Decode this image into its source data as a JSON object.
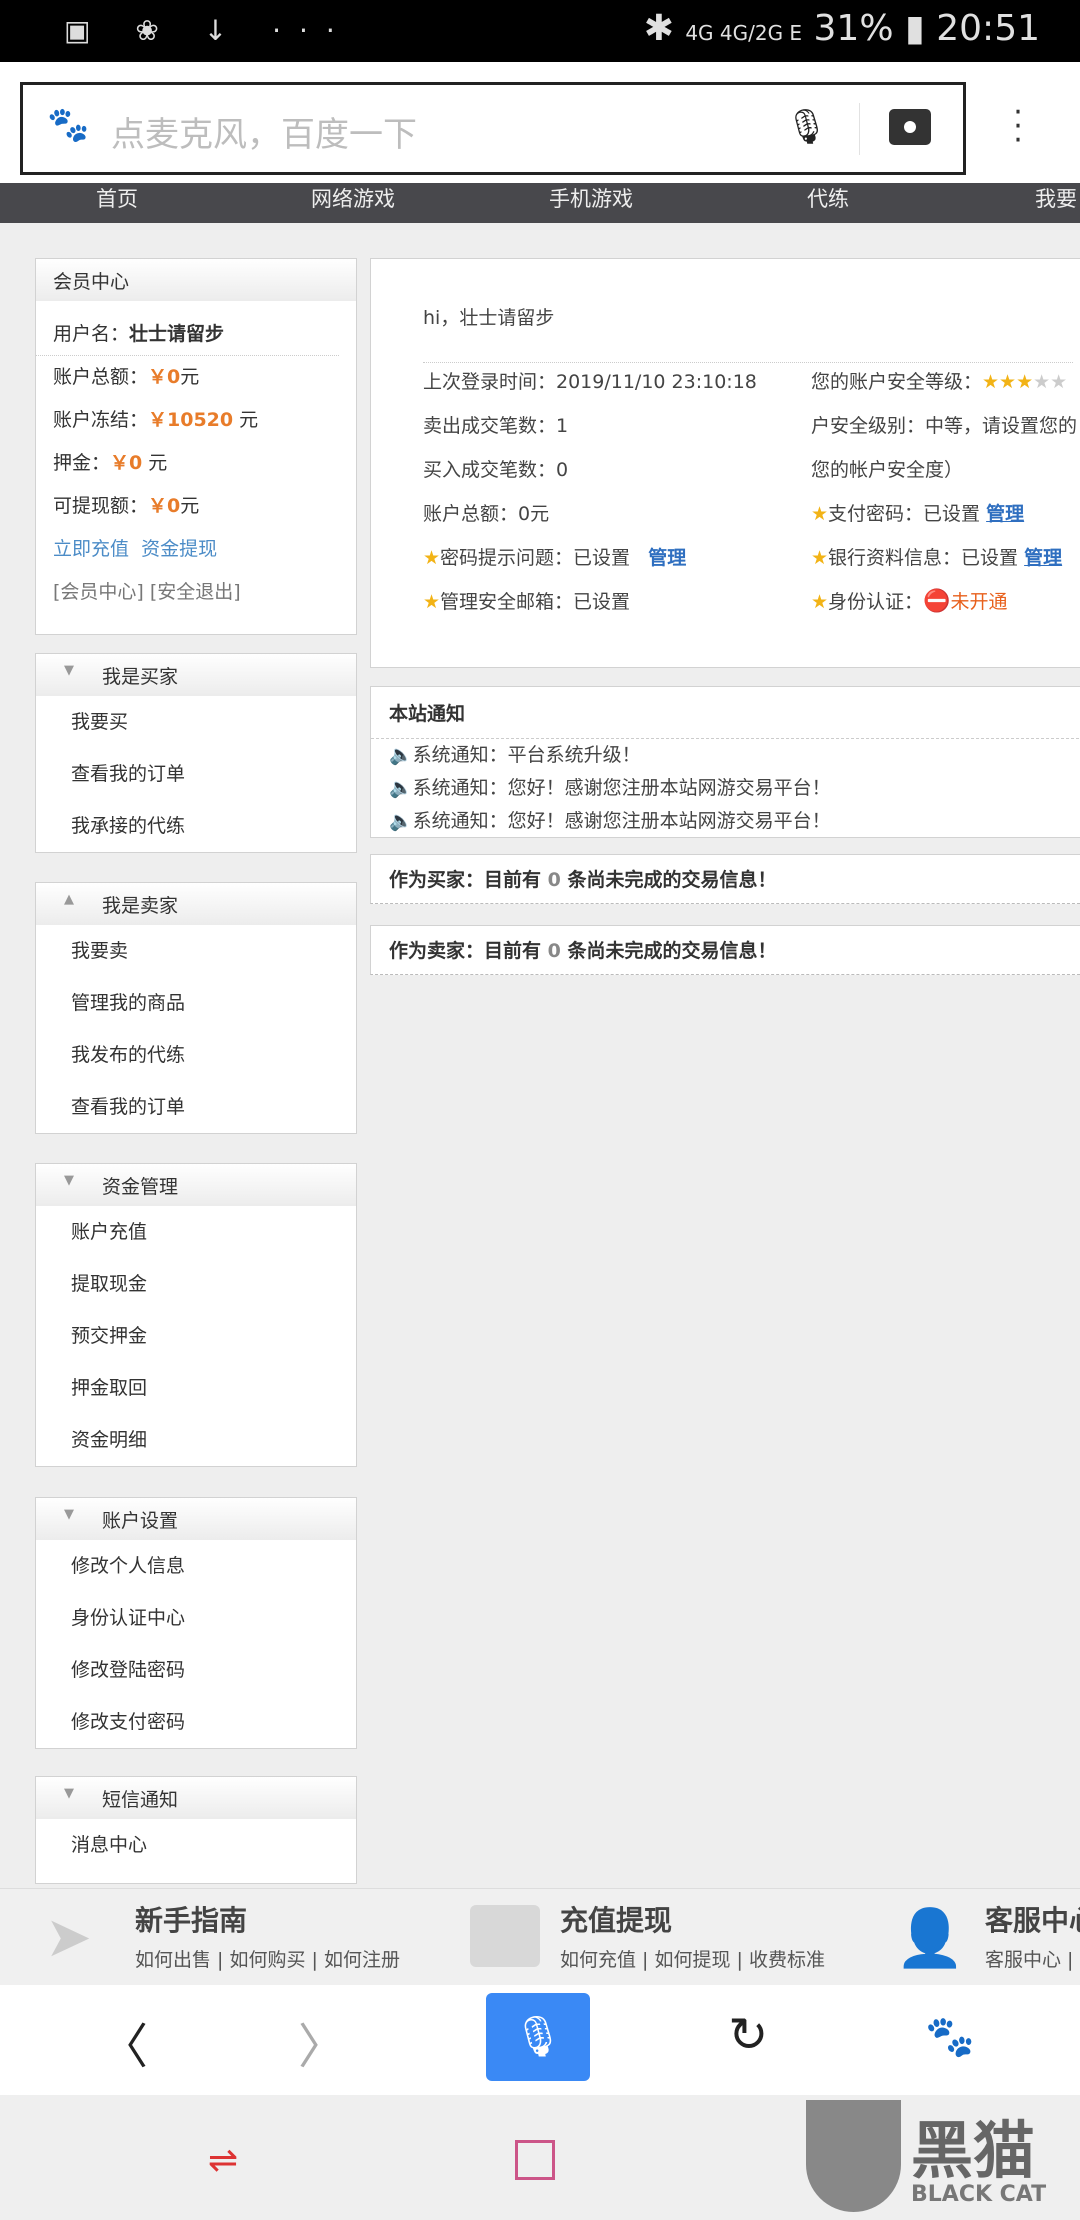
{
  "status": {
    "left_icons": "▣ ❀ ↓ ···",
    "bt": "✱",
    "battery": "31%",
    "time": "20:51",
    "network": "4G 4G/2G E"
  },
  "search": {
    "placeholder": "点麦克风，百度一下"
  },
  "nav": [
    "首页",
    "网络游戏",
    "手机游戏",
    "代练",
    "我要"
  ],
  "member": {
    "title": "会员中心",
    "username_label": "用户名：",
    "username": "壮士请留步",
    "total_label": "账户总额：",
    "total": "￥0",
    "total_unit": "元",
    "frozen_label": "账户冻结：",
    "frozen": "￥10520",
    "frozen_unit": " 元",
    "deposit_label": "押金：",
    "deposit": "￥0",
    "deposit_unit": " 元",
    "withdrawable_label": "可提现额：",
    "withdrawable": "￥0",
    "withdrawable_unit": "元",
    "recharge": "立即充值",
    "withdraw": "资金提现",
    "center": "[会员中心]",
    "logout": "[安全退出]"
  },
  "sections": [
    {
      "title": "我是买家",
      "items": [
        "我要买",
        "查看我的订单",
        "我承接的代练"
      ]
    },
    {
      "title": "我是卖家",
      "items": [
        "我要卖",
        "管理我的商品",
        "我发布的代练",
        "查看我的订单"
      ]
    },
    {
      "title": "资金管理",
      "items": [
        "账户充值",
        "提取现金",
        "预交押金",
        "押金取回",
        "资金明细"
      ]
    },
    {
      "title": "账户设置",
      "items": [
        "修改个人信息",
        "身份认证中心",
        "修改登陆密码",
        "修改支付密码"
      ]
    },
    {
      "title": "短信通知",
      "items": [
        "消息中心"
      ]
    }
  ],
  "info": {
    "greeting": "hi，壮士请留步",
    "last_login": "上次登录时间：2019/11/10 23:10:18",
    "sold": "卖出成交笔数：1",
    "bought": "买入成交笔数：0",
    "balance": "账户总额：0元",
    "pwd_hint": "密码提示问题：已设置",
    "email": "管理安全邮箱：已设置",
    "level_label": "您的账户安全等级：",
    "level_stars": 3,
    "level_max": 5,
    "level_text": "户安全级别：中等，请设置您的",
    "level_text2": "您的帐户安全度）",
    "pay_pwd": "支付密码：已设置",
    "bank": "银行资料信息：已设置",
    "id_auth": "身份认证：",
    "id_status": "未开通",
    "manage": "管理"
  },
  "notices": {
    "title": "本站通知",
    "items": [
      "系统通知：平台系统升级！",
      "系统通知：您好！感谢您注册本站网游交易平台！",
      "系统通知：您好！感谢您注册本站网游交易平台！"
    ]
  },
  "deals": {
    "buyer_pre": "作为买家：目前有 ",
    "buyer_count": "0",
    "buyer_post": " 条尚未完成的交易信息！",
    "seller_pre": "作为卖家：目前有 ",
    "seller_count": "0",
    "seller_post": " 条尚未完成的交易信息！"
  },
  "footer": [
    {
      "title": "新手指南",
      "links": "如何出售 | 如何购买 | 如何注册"
    },
    {
      "title": "充值提现",
      "links": "如何充值 | 如何提现 | 收费标准"
    },
    {
      "title": "客服中心",
      "links": "客服中心 |"
    }
  ],
  "watermark": "黑猫 BLACK CAT"
}
